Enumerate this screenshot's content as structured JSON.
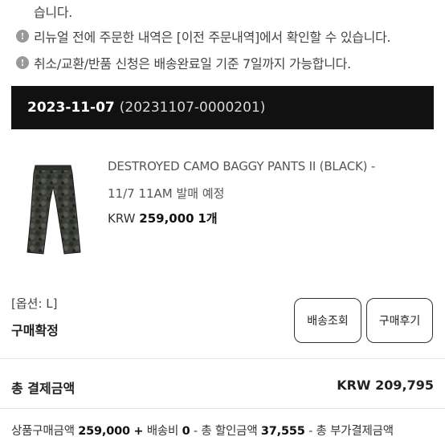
{
  "notices": {
    "cont": "습니다.",
    "line1": "리뉴얼 전에 주문한 내역은 [이전 주문내역]에서 확인할 수 있습니다.",
    "line2": "취소/교환/반품 신청은 배송완료일 기준 7일까지 가능합니다.",
    "icon": "info-icon"
  },
  "order": {
    "date": "2023-11-07",
    "number": "(20231107-0000201)"
  },
  "product": {
    "name": "DESTROYED CAMO BAGGY PANTS II (BLACK) -",
    "schedule": "11/7 11AM 발매 예정",
    "currency": "KRW",
    "price": "259,000",
    "qty": "1개",
    "image": "camo-pants-thumbnail"
  },
  "item": {
    "option": "[옵션: L]",
    "status": "구매확정"
  },
  "buttons": {
    "shipping": "배송조회",
    "review": "구매후기"
  },
  "total": {
    "label": "총 결제금액",
    "value": "KRW 209,795"
  },
  "breakdown": {
    "goods_label": "상품구매금액",
    "goods_value": "259,000",
    "plus": "+",
    "shipping_label": "배송비",
    "shipping_value": "0",
    "minus1": "-",
    "discount_label": "총 할인금액",
    "discount_value": "37,555",
    "minus2": "-",
    "extra_label": "총 부가결제금액"
  }
}
